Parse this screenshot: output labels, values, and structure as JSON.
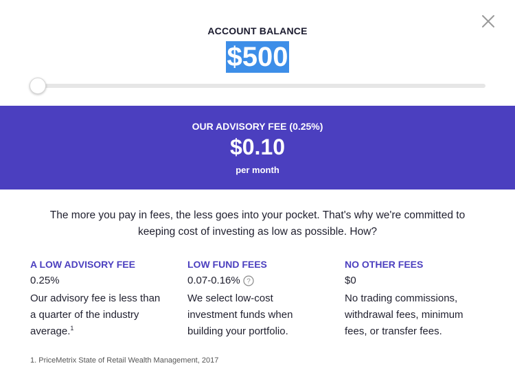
{
  "modal": {
    "close_icon": "close-icon"
  },
  "balance": {
    "label": "ACCOUNT BALANCE",
    "value": "$500",
    "slider_fraction": 0.0
  },
  "fee": {
    "label": "OUR ADVISORY FEE (0.25%)",
    "amount": "$0.10",
    "period": "per month",
    "band_color": "#4b3fbf"
  },
  "intro": "The more you pay in fees, the less goes into your pocket. That's why we're committed to keeping cost of investing as low as possible. How?",
  "columns": [
    {
      "title": "A LOW ADVISORY FEE",
      "value": "0.25%",
      "description": "Our advisory fee is less than a quarter of the industry average.",
      "footnote_marker": "1"
    },
    {
      "title": "LOW FUND FEES",
      "value": "0.07-0.16%",
      "help_icon": "question-circle-icon",
      "description": "We select low-cost investment funds when building your portfolio."
    },
    {
      "title": "NO OTHER FEES",
      "value": "$0",
      "description": "No trading commissions, withdrawal fees, minimum fees, or transfer fees."
    }
  ],
  "footnote": "1. PriceMetrix State of Retail Wealth Management, 2017",
  "colors": {
    "accent": "#4b3fbf",
    "selection": "#3d8ee8"
  }
}
